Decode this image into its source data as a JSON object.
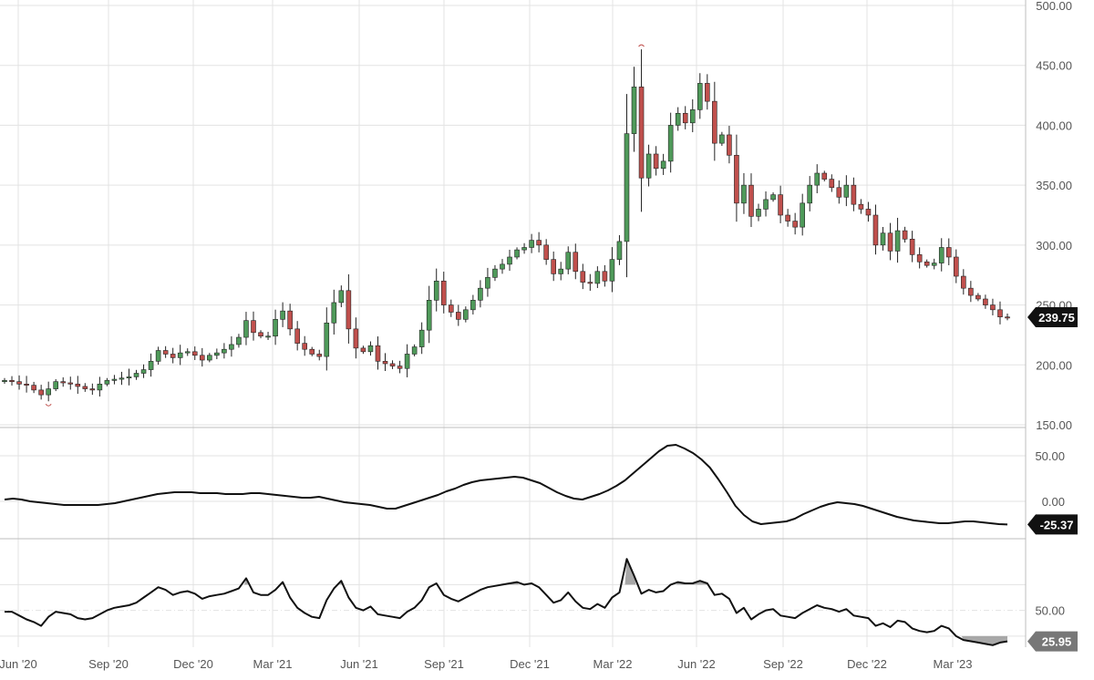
{
  "chart_data": [
    {
      "type": "candlestick",
      "panel": "price",
      "ylim": [
        150,
        500
      ],
      "yticks": [
        "150.00",
        "200.00",
        "250.00",
        "300.00",
        "350.00",
        "400.00",
        "450.00",
        "500.00"
      ],
      "last_value_label": "239.75",
      "colors": {
        "up": "#4f9a5a",
        "down": "#c0504d",
        "wick": "#222222",
        "tag": "#111111"
      },
      "marker_colors": {
        "high": "#c0504d",
        "low": "#c0504d"
      },
      "period": "weekly",
      "closes": [
        187,
        186,
        184,
        183,
        179,
        175,
        180,
        186,
        185,
        184,
        182,
        180,
        179,
        184,
        187,
        188,
        189,
        190,
        193,
        196,
        203,
        212,
        209,
        206,
        210,
        211,
        208,
        204,
        208,
        210,
        213,
        217,
        223,
        237,
        227,
        224,
        224,
        238,
        245,
        230,
        218,
        213,
        209,
        207,
        235,
        252,
        262,
        230,
        214,
        211,
        216,
        203,
        201,
        199,
        197,
        209,
        215,
        229,
        254,
        270,
        250,
        244,
        238,
        246,
        254,
        264,
        273,
        280,
        284,
        290,
        296,
        298,
        304,
        300,
        288,
        276,
        280,
        294,
        278,
        269,
        268,
        278,
        270,
        288,
        303,
        393,
        432,
        356,
        376,
        364,
        370,
        400,
        410,
        402,
        413,
        435,
        420,
        385,
        392,
        375,
        335,
        350,
        324,
        330,
        338,
        342,
        325,
        320,
        315,
        335,
        350,
        360,
        355,
        348,
        340,
        350,
        334,
        330,
        325,
        300,
        310,
        295,
        312,
        305,
        292,
        286,
        283,
        285,
        298,
        290,
        274,
        264,
        258,
        255,
        250,
        246,
        240,
        239.75
      ]
    },
    {
      "type": "line",
      "panel": "oscillator",
      "ylim": [
        -40,
        80
      ],
      "yticks": [
        "0.00",
        "50.00"
      ],
      "last_value_label": "-25.37",
      "colors": {
        "line": "#111111",
        "tag": "#111111"
      },
      "values": [
        2,
        3,
        2,
        0,
        -1,
        -2,
        -3,
        -4,
        -4,
        -4,
        -4,
        -4,
        -3,
        -2,
        0,
        2,
        4,
        6,
        8,
        9,
        10,
        10,
        10,
        9,
        9,
        9,
        8,
        8,
        8,
        9,
        9,
        8,
        7,
        6,
        5,
        4,
        4,
        5,
        3,
        1,
        -1,
        -2,
        -3,
        -4,
        -6,
        -8,
        -8,
        -5,
        -2,
        1,
        4,
        7,
        11,
        14,
        18,
        21,
        23,
        24,
        25,
        26,
        27,
        26,
        23,
        20,
        15,
        10,
        6,
        3,
        2,
        5,
        8,
        12,
        17,
        23,
        31,
        39,
        47,
        55,
        61,
        62,
        58,
        53,
        46,
        37,
        24,
        10,
        -5,
        -15,
        -22,
        -25,
        -24,
        -23,
        -22,
        -19,
        -14,
        -10,
        -6,
        -3,
        -1,
        -2,
        -3,
        -5,
        -8,
        -11,
        -14,
        -17,
        -19,
        -21,
        -22,
        -23,
        -24,
        -24,
        -23,
        -22,
        -22,
        -23,
        -24,
        -25,
        -25.37
      ]
    },
    {
      "type": "line",
      "panel": "rsi",
      "ylim": [
        20,
        105
      ],
      "yticks": [
        "50.00"
      ],
      "reference_lines": [
        30,
        50,
        70
      ],
      "last_value_label": "25.95",
      "colors": {
        "line": "#111111",
        "fill": "#999999",
        "ref": "#555555",
        "tag": "#777777"
      },
      "values": [
        49,
        49,
        46,
        43,
        41,
        38,
        45,
        49,
        48,
        47,
        44,
        43,
        44,
        47,
        50,
        52,
        53,
        54,
        56,
        60,
        64,
        68,
        66,
        62,
        64,
        65,
        63,
        59,
        61,
        62,
        63,
        65,
        67,
        75,
        64,
        62,
        62,
        66,
        72,
        60,
        52,
        48,
        45,
        44,
        58,
        67,
        73,
        60,
        52,
        50,
        53,
        47,
        46,
        45,
        44,
        49,
        52,
        58,
        68,
        71,
        62,
        59,
        57,
        60,
        63,
        66,
        68,
        69,
        70,
        71,
        72,
        70,
        71,
        68,
        62,
        56,
        58,
        64,
        57,
        52,
        51,
        55,
        52,
        60,
        64,
        90,
        77,
        63,
        66,
        64,
        65,
        70,
        72,
        71,
        71,
        73,
        71,
        62,
        63,
        59,
        48,
        52,
        43,
        47,
        50,
        51,
        46,
        45,
        44,
        48,
        51,
        54,
        52,
        51,
        49,
        51,
        46,
        45,
        44,
        38,
        40,
        37,
        42,
        41,
        36,
        34,
        33,
        34,
        38,
        36,
        30,
        27,
        26,
        25,
        24,
        23,
        25,
        25.95
      ],
      "thresholds": [
        30,
        70
      ]
    }
  ],
  "x_axis": {
    "labels": [
      "Jun '20",
      "Sep '20",
      "Dec '20",
      "Mar '21",
      "Jun '21",
      "Sep '21",
      "Dec '21",
      "Mar '22",
      "Jun '22",
      "Sep '22",
      "Dec '22",
      "Mar '23"
    ]
  }
}
